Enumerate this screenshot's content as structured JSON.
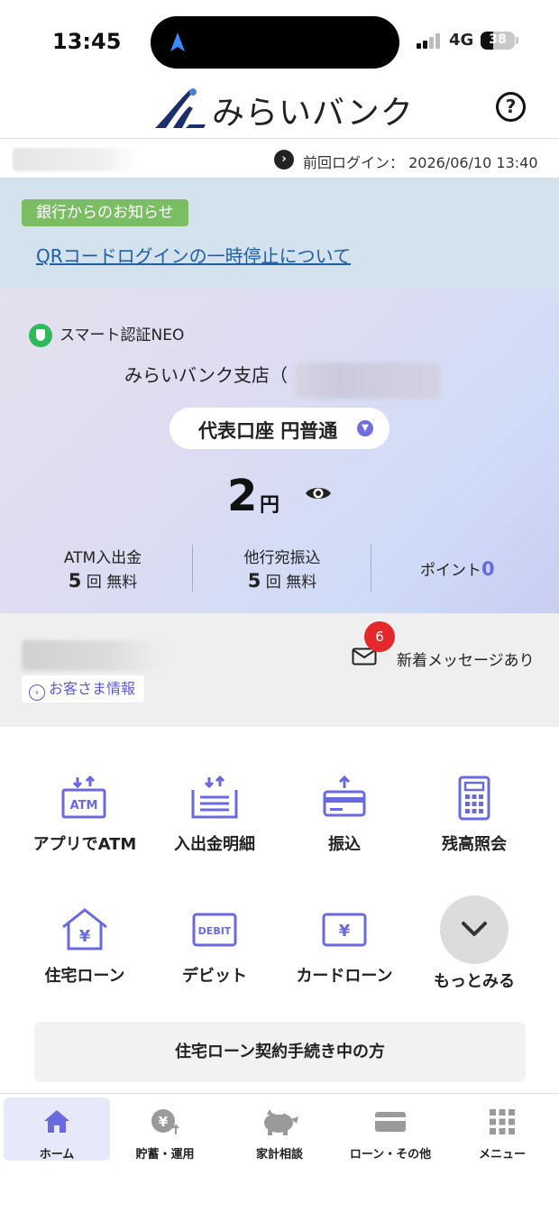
{
  "status_bar": {
    "time": "13:45",
    "network": "4G",
    "battery_level": "38",
    "battery_fraction": 0.38
  },
  "header": {
    "logo_text": "みらいバンク",
    "help_glyph": "?"
  },
  "login": {
    "last_login": "前回ログイン： 2026/06/10 13:40"
  },
  "notice": {
    "badge": "銀行からのお知らせ",
    "link": "QRコードログインの一時停止について"
  },
  "account": {
    "smart_auth": "スマート認証NEO",
    "branch": "みらいバンク支店（",
    "account_type": "代表口座 円普通",
    "balance": "2",
    "currency": "円",
    "atm": {
      "title": "ATM入出金",
      "count": "5",
      "unit": " 回 無料"
    },
    "transfer": {
      "title": "他行宛振込",
      "count": "5",
      "unit": " 回 無料"
    },
    "points_label": "ポイント",
    "points_value": "0"
  },
  "customer": {
    "info_button": "お客さま情報",
    "message_count": "6",
    "message_text": "新着メッセージあり"
  },
  "menu": [
    {
      "label": "アプリでATM",
      "icon": "atm-icon"
    },
    {
      "label": "入出金明細",
      "icon": "statement-icon"
    },
    {
      "label": "振込",
      "icon": "transfer-icon"
    },
    {
      "label": "残高照会",
      "icon": "calculator-icon"
    },
    {
      "label": "住宅ローン",
      "icon": "house-yen-icon"
    },
    {
      "label": "デビット",
      "icon": "debit-card-icon"
    },
    {
      "label": "カードローン",
      "icon": "yen-card-icon"
    },
    {
      "label": "もっとみる",
      "icon": "chevron-down-icon"
    }
  ],
  "housing_button": "住宅ローン契約手続き中の方",
  "tabs": [
    {
      "label": "ホーム",
      "icon": "home-icon"
    },
    {
      "label": "貯蓄・運用",
      "icon": "yen-coin-icon"
    },
    {
      "label": "家計相談",
      "icon": "piggy-bank-icon"
    },
    {
      "label": "ローン・その他",
      "icon": "card-icon"
    },
    {
      "label": "メニュー",
      "icon": "grid-icon"
    }
  ],
  "colors": {
    "accent": "#6a6ae0",
    "notice_bg": "#d4e2ee",
    "badge_green": "#7bbd63",
    "alert_red": "#e6282d",
    "link_blue": "#1f5fa8"
  }
}
